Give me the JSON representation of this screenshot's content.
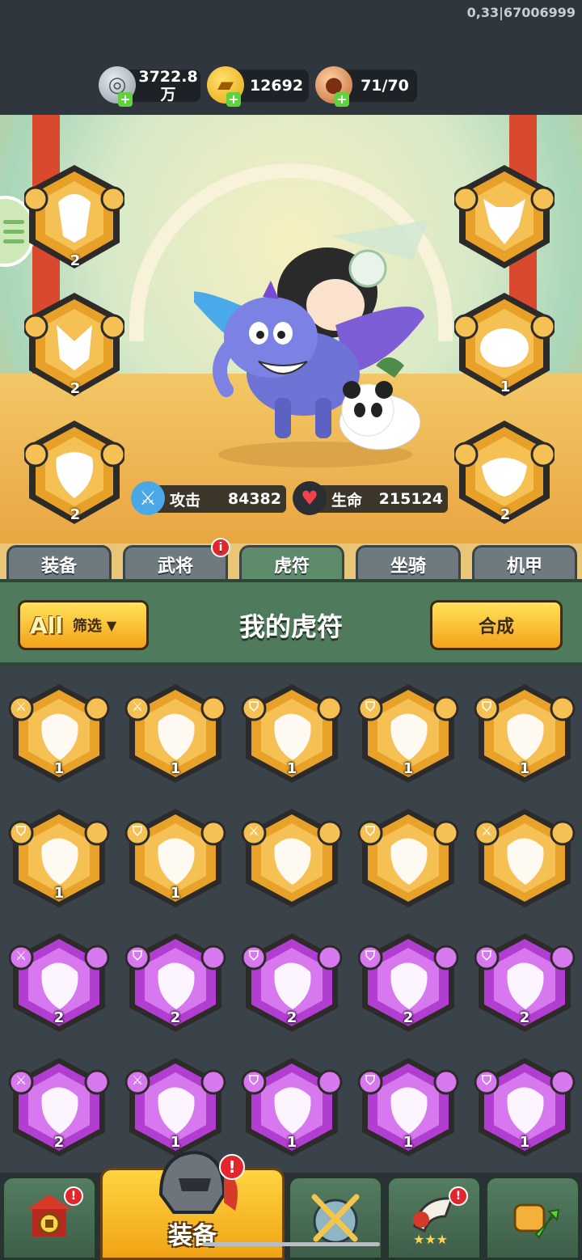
{
  "build_id": "0,33|67006999",
  "currencies": {
    "coin": {
      "value": "3722.8 万",
      "icon": "silver-coin-icon"
    },
    "ingot": {
      "value": "12692",
      "icon": "gold-ingot-icon"
    },
    "stamina": {
      "value": "71/70",
      "icon": "meat-icon"
    }
  },
  "stats": {
    "attack_label": "攻击",
    "attack_value": "84382",
    "hp_label": "生命",
    "hp_value": "215124"
  },
  "equipped_left": [
    {
      "name": "deer",
      "level": "2",
      "rarity": "gold"
    },
    {
      "name": "fox",
      "level": "2",
      "rarity": "gold"
    },
    {
      "name": "tiger",
      "level": "2",
      "rarity": "gold"
    }
  ],
  "equipped_right": [
    {
      "name": "ox",
      "level": "",
      "rarity": "gold"
    },
    {
      "name": "tortoise",
      "level": "1",
      "rarity": "gold"
    },
    {
      "name": "boar",
      "level": "2",
      "rarity": "gold"
    }
  ],
  "tabs": [
    {
      "label": "装备",
      "active": false,
      "badge": ""
    },
    {
      "label": "武将",
      "active": false,
      "badge": "i"
    },
    {
      "label": "虎符",
      "active": true,
      "badge": ""
    },
    {
      "label": "坐骑",
      "active": false,
      "badge": ""
    },
    {
      "label": "机甲",
      "active": false,
      "badge": ""
    }
  ],
  "panel": {
    "filter_all": "All",
    "filter_label": "筛选",
    "title": "我的虎符",
    "compose_label": "合成"
  },
  "tokens": [
    [
      {
        "level": "1",
        "rarity": "gold",
        "type": "sword"
      },
      {
        "level": "1",
        "rarity": "gold",
        "type": "sword"
      },
      {
        "level": "1",
        "rarity": "gold",
        "type": "shield"
      },
      {
        "level": "1",
        "rarity": "gold",
        "type": "shield"
      },
      {
        "level": "1",
        "rarity": "gold",
        "type": "shield"
      }
    ],
    [
      {
        "level": "1",
        "rarity": "gold",
        "type": "shield"
      },
      {
        "level": "1",
        "rarity": "gold",
        "type": "shield"
      },
      {
        "level": "",
        "rarity": "gold",
        "type": "sword"
      },
      {
        "level": "",
        "rarity": "gold",
        "type": "shield"
      },
      {
        "level": "",
        "rarity": "gold",
        "type": "sword"
      }
    ],
    [
      {
        "level": "2",
        "rarity": "purple",
        "type": "sword"
      },
      {
        "level": "2",
        "rarity": "purple",
        "type": "shield"
      },
      {
        "level": "2",
        "rarity": "purple",
        "type": "shield"
      },
      {
        "level": "2",
        "rarity": "purple",
        "type": "shield"
      },
      {
        "level": "2",
        "rarity": "purple",
        "type": "shield"
      }
    ],
    [
      {
        "level": "2",
        "rarity": "purple",
        "type": "sword"
      },
      {
        "level": "1",
        "rarity": "purple",
        "type": "sword"
      },
      {
        "level": "1",
        "rarity": "purple",
        "type": "shield"
      },
      {
        "level": "1",
        "rarity": "purple",
        "type": "shield"
      },
      {
        "level": "1",
        "rarity": "purple",
        "type": "shield"
      }
    ]
  ],
  "bottom_nav": [
    {
      "name": "shop",
      "label": "",
      "active": false,
      "badge": "!",
      "icon": "pagoda-icon"
    },
    {
      "name": "equipment",
      "label": "装备",
      "active": true,
      "badge": "!",
      "icon": "helmet-icon"
    },
    {
      "name": "battle",
      "label": "",
      "active": false,
      "badge": "",
      "icon": "crossed-swords-icon"
    },
    {
      "name": "stars",
      "label": "",
      "active": false,
      "badge": "!",
      "icon": "horn-icon"
    },
    {
      "name": "upgrade",
      "label": "",
      "active": false,
      "badge": "",
      "icon": "fist-icon"
    }
  ],
  "colors": {
    "gold_outer": "#e8a22a",
    "gold_inner": "#f6c154",
    "purple_outer": "#b13ed0",
    "purple_inner": "#d778ef"
  }
}
